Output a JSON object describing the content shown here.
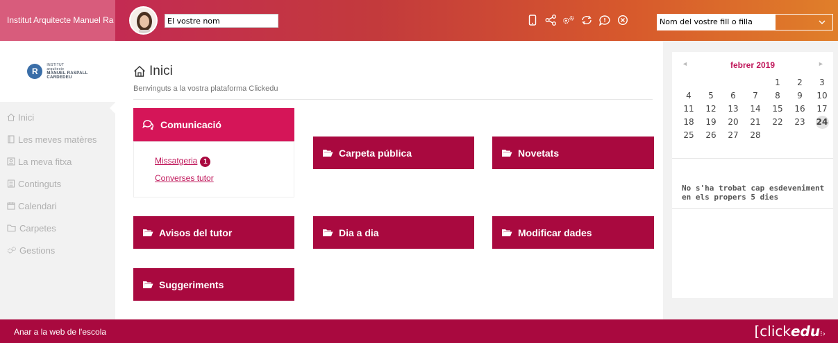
{
  "header": {
    "school_name": "Institut Arquitecte Manuel Ra",
    "name_value": "El vostre nom",
    "child_select_value": "Nom del vostre fill o filla",
    "icons": [
      "mobile-icon",
      "share-icon",
      "settings-icon",
      "sync-icon",
      "chat-icon",
      "close-icon"
    ]
  },
  "sidebar": {
    "logo": {
      "line1": "INSTITUT",
      "line2": "arquitecte",
      "line3": "MANUEL RASPALL",
      "line4": "CARDEDEU"
    },
    "items": [
      {
        "label": "Inici",
        "icon": "home-icon"
      },
      {
        "label": "Les meves matères",
        "icon": "book-icon"
      },
      {
        "label": "La meva fitxa",
        "icon": "profile-card-icon"
      },
      {
        "label": "Continguts",
        "icon": "document-icon"
      },
      {
        "label": "Calendari",
        "icon": "calendar-icon"
      },
      {
        "label": "Carpetes",
        "icon": "folder-icon"
      },
      {
        "label": "Gestions",
        "icon": "gears-icon"
      }
    ]
  },
  "main": {
    "title": "Inici",
    "subtitle": "Benvinguts a la vostra plataforma Clickedu",
    "communication": {
      "title": "Comunicació",
      "messages_label": "Missatgeria",
      "messages_count": "1",
      "tutor_label": "Converses tutor"
    },
    "tiles": {
      "public_folder": "Carpeta pública",
      "news": "Novetats",
      "tutor_notices": "Avisos del tutor",
      "daily": "Dia a dia",
      "edit_data": "Modificar dades",
      "suggestions": "Suggeriments"
    }
  },
  "calendar": {
    "month": "febrer 2019",
    "prev": "◄",
    "next": "►",
    "weeks": [
      [
        "",
        "",
        "",
        "",
        "1",
        "2",
        "3"
      ],
      [
        "4",
        "5",
        "6",
        "7",
        "8",
        "9",
        "10"
      ],
      [
        "11",
        "12",
        "13",
        "14",
        "15",
        "16",
        "17"
      ],
      [
        "18",
        "19",
        "20",
        "21",
        "22",
        "23",
        "24"
      ],
      [
        "25",
        "26",
        "27",
        "28",
        "",
        "",
        ""
      ]
    ],
    "today": "24",
    "no_events": "No s'ha trobat cap esdeveniment en els propers 5 dies"
  },
  "footer": {
    "school_link": "Anar a la web de l'escola",
    "brand_prefix": "[click",
    "brand_bold": "edu"
  },
  "colors": {
    "primary": "#a9093f",
    "accent": "#d51558"
  }
}
